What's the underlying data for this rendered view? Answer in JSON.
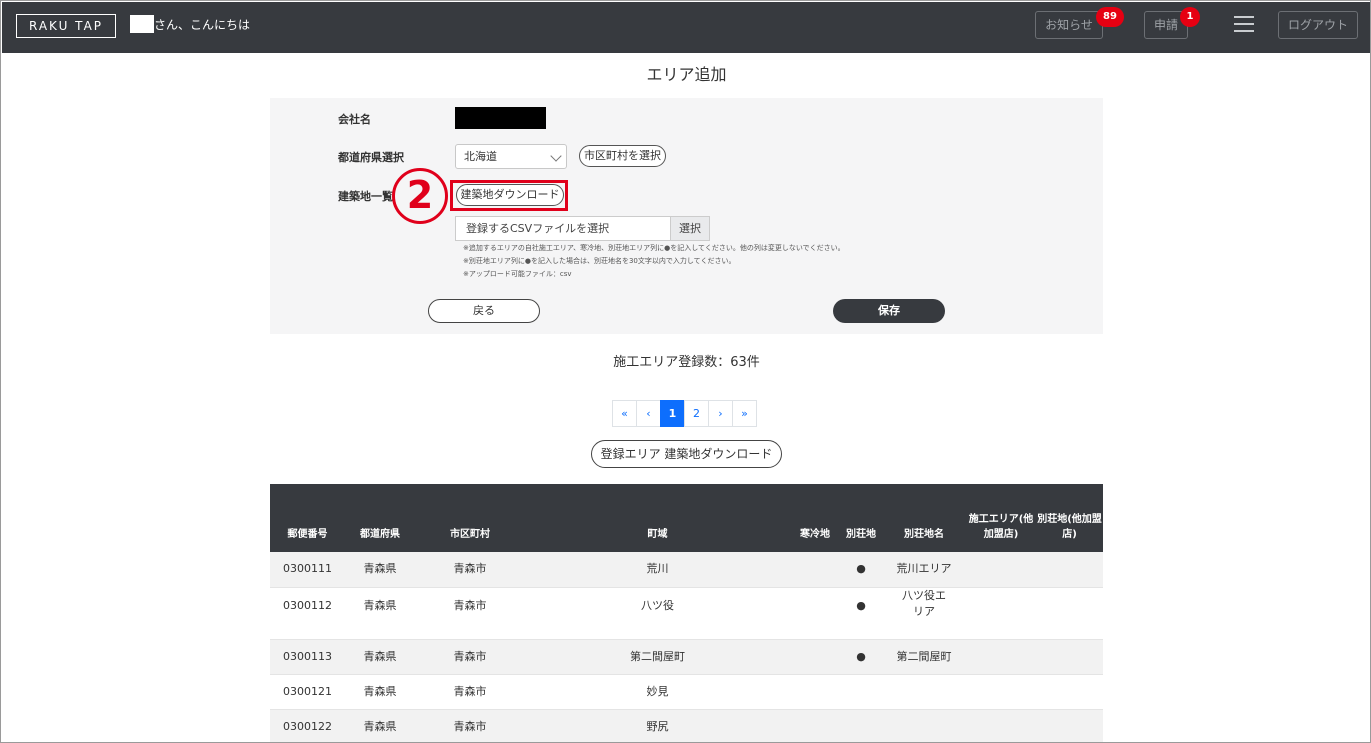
{
  "header": {
    "logo_text": "RAKU TAP",
    "greeting": "さん、こんにちは",
    "notice_label": "お知らせ",
    "notice_count": "89",
    "apply_label": "申請",
    "apply_count": "1",
    "logout_label": "ログアウト"
  },
  "page_title": "エリア追加",
  "form": {
    "company_label": "会社名",
    "prefecture_label": "都道府県選択",
    "prefecture_value": "北海道",
    "city_button": "市区町村を選択",
    "building_list_label": "建築地一覧",
    "building_download_button": "建築地ダウンロード",
    "step_marker": "2",
    "file_placeholder": "登録するCSVファイルを選択",
    "file_button": "選択",
    "notes": [
      "※追加するエリアの自社施工エリア、寒冷地、別荘地エリア列に●を記入してください。他の列は変更しないでください。",
      "※別荘地エリア列に●を記入した場合は、別荘地名を30文字以内で入力してください。",
      "※アップロード可能ファイル：csv"
    ],
    "back_button": "戻る",
    "save_button": "保存"
  },
  "registration_count": "施工エリア登録数：63件",
  "pagination": {
    "first": "«",
    "prev": "‹",
    "pages": [
      "1",
      "2"
    ],
    "next": "›",
    "last": "»"
  },
  "registered_download_button": "登録エリア 建築地ダウンロード",
  "table": {
    "headers": [
      "郵便番号",
      "都道府県",
      "市区町村",
      "町域",
      "寒冷地",
      "別荘地",
      "別荘地名",
      "施工エリア(他加盟店)",
      "別荘地(他加盟店)"
    ],
    "rows": [
      [
        "0300111",
        "青森県",
        "青森市",
        "荒川",
        "",
        "●",
        "荒川エリア",
        "",
        ""
      ],
      [
        "0300112",
        "青森県",
        "青森市",
        "八ツ役",
        "",
        "●",
        "八ツ役エリア",
        "",
        ""
      ],
      [
        "0300113",
        "青森県",
        "青森市",
        "第二間屋町",
        "",
        "●",
        "第二間屋町",
        "",
        ""
      ],
      [
        "0300121",
        "青森県",
        "青森市",
        "妙見",
        "",
        "",
        "",
        "",
        ""
      ],
      [
        "0300122",
        "青森県",
        "青森市",
        "野尻",
        "",
        "",
        "",
        "",
        ""
      ]
    ]
  }
}
